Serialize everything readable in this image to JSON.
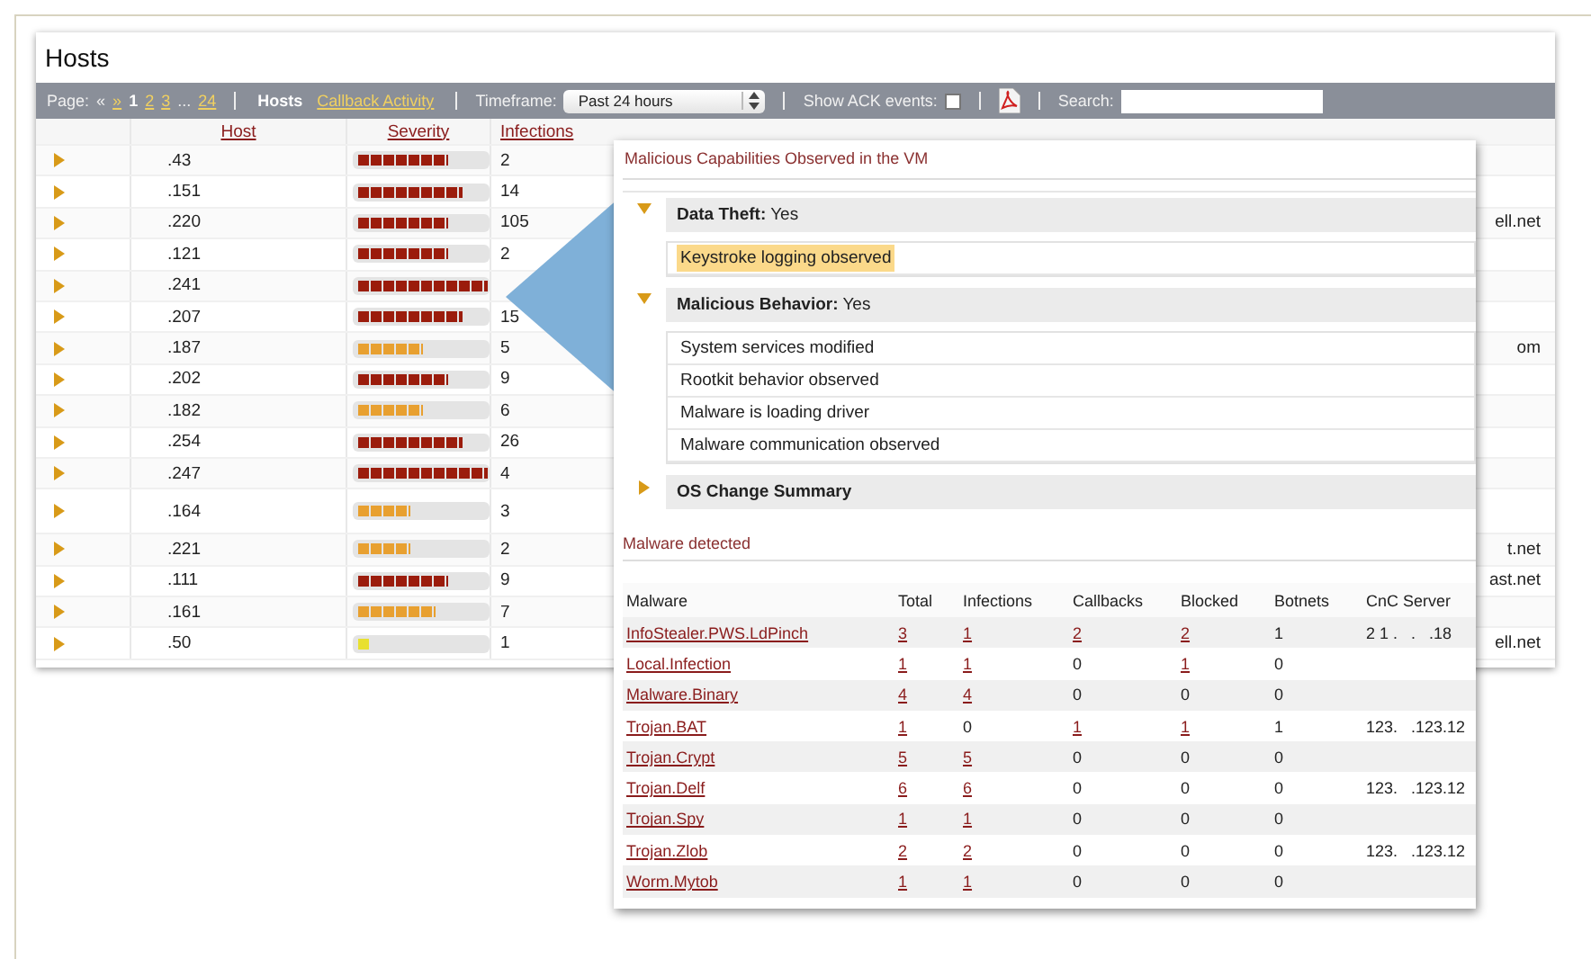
{
  "title": "Hosts",
  "toolbar": {
    "page_label": "Page:",
    "prev": "«",
    "next": "»",
    "pages": [
      {
        "kind": "page",
        "label": "1",
        "selected": true
      },
      {
        "kind": "page",
        "label": "2",
        "selected": false
      },
      {
        "kind": "page",
        "label": "3",
        "selected": false
      },
      {
        "kind": "gap",
        "label": "..."
      },
      {
        "kind": "page",
        "label": "24",
        "selected": false
      }
    ],
    "views": [
      {
        "label": "Hosts",
        "selected": true
      },
      {
        "label": "Callback Activity",
        "selected": false
      }
    ],
    "timeframe_label": "Timeframe:",
    "timeframe": "Past 24 hours",
    "ack_label": "Show ACK events:",
    "ack_checked": false,
    "search_label": "Search:"
  },
  "hosts": {
    "columns": [
      "Host",
      "Severity",
      "Infections"
    ],
    "rows": [
      {
        "host": ".43",
        "level": 0.7,
        "color": "#9b1c0c",
        "infections": "2"
      },
      {
        "host": ".151",
        "level": 0.8,
        "color": "#9b1c0c",
        "infections": "14"
      },
      {
        "host": ".220",
        "level": 0.7,
        "color": "#9b1c0c",
        "infections": "105",
        "domain": "ell.net"
      },
      {
        "host": ".121",
        "level": 0.7,
        "color": "#9b1c0c",
        "infections": "2"
      },
      {
        "host": ".241",
        "level": 1.0,
        "color": "#9b1c0c"
      },
      {
        "host": ".207",
        "level": 0.8,
        "color": "#9b1c0c",
        "infections": "15"
      },
      {
        "host": ".187",
        "level": 0.5,
        "color": "#e8a030",
        "infections": "5",
        "domain": "om"
      },
      {
        "host": ".202",
        "level": 0.7,
        "color": "#9b1c0c",
        "infections": "9"
      },
      {
        "host": ".182",
        "level": 0.5,
        "color": "#e8a030",
        "infections": "6"
      },
      {
        "host": ".254",
        "level": 0.8,
        "color": "#9b1c0c",
        "infections": "26"
      },
      {
        "host": ".247",
        "level": 1.0,
        "color": "#9b1c0c",
        "infections": "4"
      },
      {
        "host": ".164",
        "level": 0.4,
        "color": "#e8a030",
        "infections": "3"
      },
      {
        "host": ".221",
        "level": 0.4,
        "color": "#e8a030",
        "infections": "2",
        "domain": "t.net"
      },
      {
        "host": ".111",
        "level": 0.7,
        "color": "#9b1c0c",
        "infections": "9",
        "domain": "ast.net"
      },
      {
        "host": ".161",
        "level": 0.6,
        "color": "#e8a030",
        "infections": "7"
      },
      {
        "host": ".50",
        "level": 0.1,
        "color": "#e8e030",
        "infections": "1",
        "domain": "ell.net"
      }
    ]
  },
  "popup": {
    "title": "Malicious Capabilities Observed in the VM",
    "sections": [
      {
        "heading": "**Data Theft:** Yes",
        "expanded": true,
        "items": [
          {
            "text": "Keystroke logging observed",
            "highlighted": true
          }
        ]
      },
      {
        "heading": "**Malicious Behavior:** Yes",
        "expanded": true,
        "items": [
          {
            "text": "System services modified",
            "highlighted": false
          },
          {
            "text": "Rootkit behavior observed",
            "highlighted": false
          },
          {
            "text": "Malware is loading driver",
            "highlighted": false
          },
          {
            "text": "Malware communication observed",
            "highlighted": false
          }
        ]
      },
      {
        "heading": "**OS Change Summary**",
        "expanded": false
      }
    ],
    "malware_title": "Malware detected",
    "columns": [
      "Malware",
      "Total",
      "Infections",
      "Callbacks",
      "Blocked",
      "Botnets",
      "CnC Server"
    ],
    "rows": [
      [
        {
          "text": "InfoStealer.PWS.LdPinch",
          "link": true
        },
        {
          "text": "3",
          "link": true
        },
        {
          "text": "1",
          "link": true
        },
        {
          "text": "2",
          "link": true
        },
        {
          "text": "2",
          "link": true
        },
        {
          "text": "1",
          "link": false
        },
        {
          "text": "2 1 .   .   .18",
          "link": false
        }
      ],
      [
        {
          "text": "Local.Infection",
          "link": true
        },
        {
          "text": "1",
          "link": true
        },
        {
          "text": "1",
          "link": true
        },
        {
          "text": "0",
          "link": false
        },
        {
          "text": "1",
          "link": true
        },
        {
          "text": "0",
          "link": false
        }
      ],
      [
        {
          "text": "Malware.Binary",
          "link": true
        },
        {
          "text": "4",
          "link": true
        },
        {
          "text": "4",
          "link": true
        },
        {
          "text": "0",
          "link": false
        },
        {
          "text": "0",
          "link": false
        },
        {
          "text": "0",
          "link": false
        }
      ],
      [
        {
          "text": "Trojan.BAT",
          "link": true
        },
        {
          "text": "1",
          "link": true
        },
        {
          "text": "0",
          "link": false
        },
        {
          "text": "1",
          "link": true
        },
        {
          "text": "1",
          "link": true
        },
        {
          "text": "1",
          "link": false
        },
        {
          "text": "123.   .123.12",
          "link": false
        }
      ],
      [
        {
          "text": "Trojan.Crypt",
          "link": true
        },
        {
          "text": "5",
          "link": true
        },
        {
          "text": "5",
          "link": true
        },
        {
          "text": "0",
          "link": false
        },
        {
          "text": "0",
          "link": false
        },
        {
          "text": "0",
          "link": false
        }
      ],
      [
        {
          "text": "Trojan.Delf",
          "link": true
        },
        {
          "text": "6",
          "link": true
        },
        {
          "text": "6",
          "link": true
        },
        {
          "text": "0",
          "link": false
        },
        {
          "text": "0",
          "link": false
        },
        {
          "text": "0",
          "link": false
        },
        {
          "text": "123.   .123.12",
          "link": false
        }
      ],
      [
        {
          "text": "Trojan.Spy",
          "link": true
        },
        {
          "text": "1",
          "link": true
        },
        {
          "text": "1",
          "link": true
        },
        {
          "text": "0",
          "link": false
        },
        {
          "text": "0",
          "link": false
        },
        {
          "text": "0",
          "link": false
        }
      ],
      [
        {
          "text": "Trojan.Zlob",
          "link": true
        },
        {
          "text": "2",
          "link": true
        },
        {
          "text": "2",
          "link": true
        },
        {
          "text": "0",
          "link": false
        },
        {
          "text": "0",
          "link": false
        },
        {
          "text": "0",
          "link": false
        },
        {
          "text": "123.   .123.12",
          "link": false
        }
      ],
      [
        {
          "text": "Worm.Mytob",
          "link": true
        },
        {
          "text": "1",
          "link": true
        },
        {
          "text": "1",
          "link": true
        },
        {
          "text": "0",
          "link": false
        },
        {
          "text": "0",
          "link": false
        },
        {
          "text": "0",
          "link": false
        }
      ]
    ]
  }
}
